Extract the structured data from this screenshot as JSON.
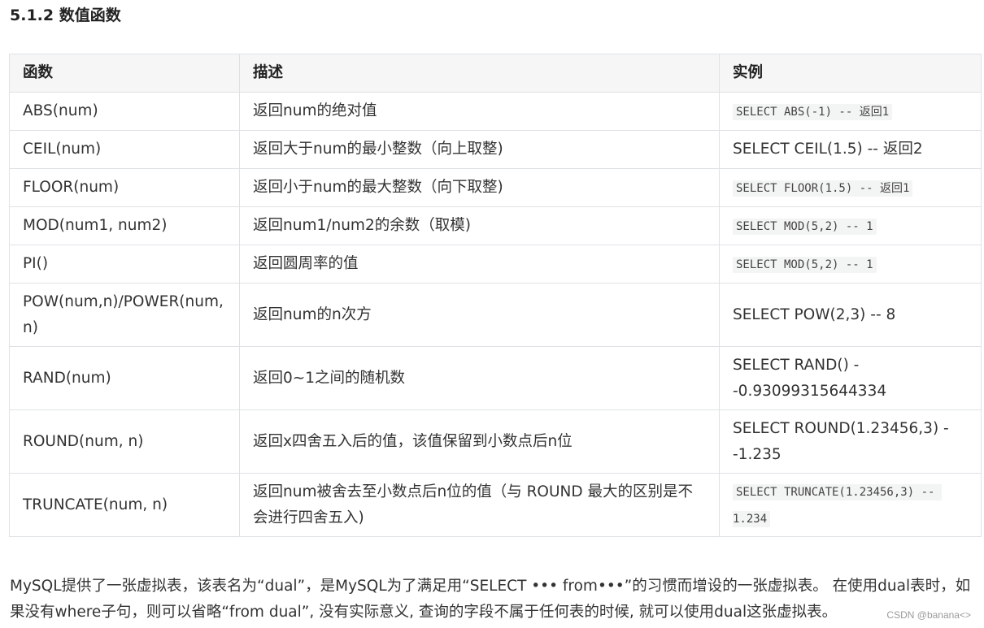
{
  "section_title": "5.1.2 数值函数",
  "table": {
    "headers": [
      "函数",
      "描述",
      "实例"
    ],
    "rows": [
      {
        "func": "ABS(num)",
        "desc": "返回num的绝对值",
        "example": "SELECT ABS(-1) -- 返回1",
        "example_is_code": true
      },
      {
        "func": "CEIL(num)",
        "desc": "返回大于num的最小整数（向上取整)",
        "example": "SELECT CEIL(1.5) -- 返回2",
        "example_is_code": false
      },
      {
        "func": "FLOOR(num)",
        "desc": "返回小于num的最大整数（向下取整)",
        "example": "SELECT FLOOR(1.5) -- 返回1",
        "example_is_code": true
      },
      {
        "func": "MOD(num1, num2)",
        "desc": "返回num1/num2的余数（取模)",
        "example": "SELECT MOD(5,2) -- 1",
        "example_is_code": true
      },
      {
        "func": "PI()",
        "desc": "返回圆周率的值",
        "example": "SELECT MOD(5,2) -- 1",
        "example_is_code": true
      },
      {
        "func": "POW(num,n)/POWER(num, n)",
        "desc": "返回num的n次方",
        "example": "SELECT POW(2,3) -- 8",
        "example_is_code": false
      },
      {
        "func": "RAND(num)",
        "desc": "返回0~1之间的随机数",
        "example": "SELECT RAND() --0.93099315644334",
        "example_is_code": false
      },
      {
        "func": "ROUND(num, n)",
        "desc": "返回x四舍五入后的值，该值保留到小数点后n位",
        "example": "SELECT ROUND(1.23456,3) --1.235",
        "example_is_code": false
      },
      {
        "func": "TRUNCATE(num, n)",
        "desc": "返回num被舍去至小数点后n位的值（与 ROUND 最大的区别是不会进行四舍五入)",
        "example": "SELECT TRUNCATE(1.23456,3) -- 1.234",
        "example_is_code": true
      }
    ]
  },
  "paragraph": "MySQL提供了一张虚拟表，该表名为“dual”，是MySQL为了满足用“SELECT ••• from•••”的习惯而增设的一张虚拟表。 在使用dual表时，如果没有where子句，则可以省略“from dual”, 没有实际意义, 查询的字段不属于任何表的时候, 就可以使用dual这张虚拟表。",
  "watermark": "CSDN @banana<>"
}
